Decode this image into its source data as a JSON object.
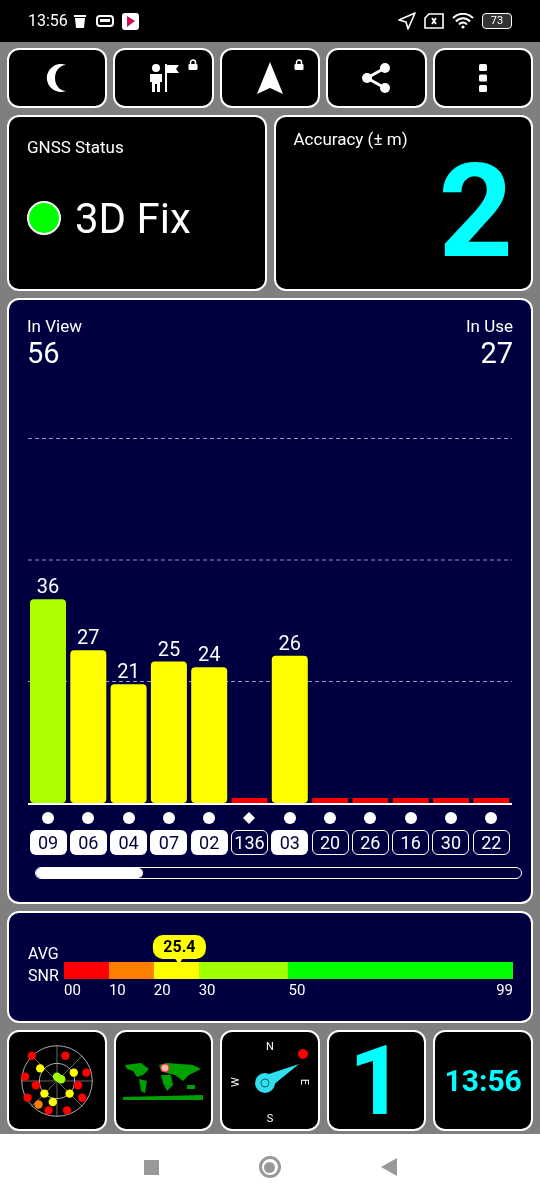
{
  "status_bar": {
    "time": "13:56",
    "battery": "73"
  },
  "toolbar": [
    {
      "kind": "moon",
      "locked": false
    },
    {
      "kind": "person-flag",
      "locked": true
    },
    {
      "kind": "arrow",
      "locked": true
    },
    {
      "kind": "share",
      "locked": false
    },
    {
      "kind": "more",
      "locked": false
    }
  ],
  "gnss_status": {
    "title": "GNSS Status",
    "value": "3D Fix",
    "color": "#00ff00"
  },
  "accuracy": {
    "title": "Accuracy (± m)",
    "value": "2"
  },
  "satellites_panel": {
    "in_view_label": "In View",
    "in_view": "56",
    "in_use_label": "In Use",
    "in_use": "27",
    "chart_data": {
      "type": "bar",
      "categories": [
        "09",
        "06",
        "04",
        "07",
        "02",
        "136",
        "03",
        "20",
        "26",
        "16",
        "30",
        "22"
      ],
      "values": [
        36,
        27,
        21,
        25,
        24,
        0,
        26,
        0,
        0,
        0,
        0,
        0
      ],
      "value_labels": [
        "36",
        "27",
        "21",
        "25",
        "24",
        null,
        "26",
        null,
        null,
        null,
        null,
        null
      ]
    },
    "satellites": [
      {
        "kind": "dot",
        "used": true,
        "color": "#aaff00"
      },
      {
        "kind": "dot",
        "used": true,
        "color": "#ffff00"
      },
      {
        "kind": "dot",
        "used": true,
        "color": "#ffff00"
      },
      {
        "kind": "dot",
        "used": true,
        "color": "#ffff00"
      },
      {
        "kind": "dot",
        "used": true,
        "color": "#ffff00"
      },
      {
        "kind": "diamond",
        "used": false,
        "color": "#ff0000"
      },
      {
        "kind": "dot",
        "used": true,
        "color": "#ffff00"
      },
      {
        "kind": "dot",
        "used": false,
        "color": "#ff0000"
      },
      {
        "kind": "dot",
        "used": false,
        "color": "#ff0000"
      },
      {
        "kind": "dot",
        "used": false,
        "color": "#ff0000"
      },
      {
        "kind": "dot",
        "used": false,
        "color": "#ff0000"
      },
      {
        "kind": "dot",
        "used": false,
        "color": "#ff0000"
      }
    ]
  },
  "snr": {
    "label_1": "AVG",
    "label_2": "SNR",
    "reading": "25.4",
    "segments": [
      {
        "color": "#ff0000"
      },
      {
        "color": "#ff8000"
      },
      {
        "color": "#ffff00"
      },
      {
        "color": "#a0ff00"
      },
      {
        "color": "#00ff00"
      }
    ],
    "ticks": [
      "00",
      "10",
      "20",
      "30",
      "50",
      "99"
    ]
  },
  "tiles": [
    {
      "kind": "skyplot"
    },
    {
      "kind": "map"
    },
    {
      "kind": "compass",
      "labels": [
        "N",
        "E",
        "S",
        "W"
      ]
    },
    {
      "kind": "number",
      "value": "1"
    },
    {
      "kind": "clock",
      "value": "13:56"
    }
  ]
}
